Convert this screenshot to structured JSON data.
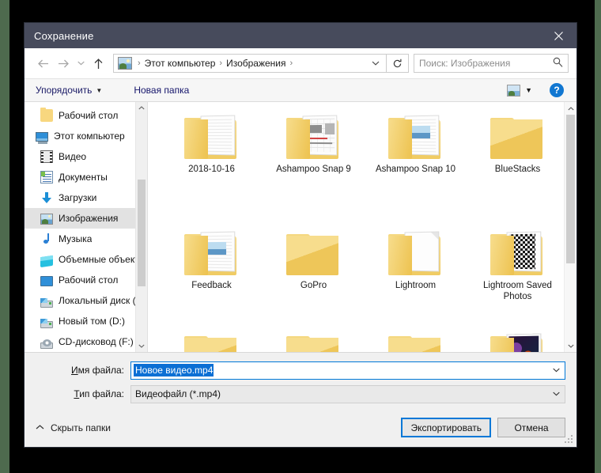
{
  "window": {
    "title": "Сохранение",
    "close_label": "×"
  },
  "nav": {
    "back_icon": "arrow-left-icon",
    "forward_icon": "arrow-right-icon",
    "recent_icon": "chevron-down-icon",
    "up_icon": "arrow-up-icon",
    "breadcrumbs": [
      "Этот компьютер",
      "Изображения"
    ],
    "separator": "›",
    "dropdown_icon": "chevron-down-icon",
    "refresh_icon": "refresh-icon",
    "refresh_glyph": "↻"
  },
  "search": {
    "placeholder": "Поиск: Изображения",
    "value": "",
    "icon": "search-icon"
  },
  "toolbar": {
    "organize_label": "Упорядочить",
    "organize_caret": "▼",
    "new_folder_label": "Новая папка",
    "view_icon": "picture-view-icon",
    "view_caret": "▼",
    "help_label": "?"
  },
  "sidebar": {
    "scroll_up_icon": "▲",
    "scroll_down_icon": "▼",
    "items": [
      {
        "label": "Рабочий стол",
        "icon": "folder-icon",
        "indent": true,
        "selected": false
      },
      {
        "label": "Этот компьютер",
        "icon": "computer-icon",
        "indent": false,
        "selected": false
      },
      {
        "label": "Видео",
        "icon": "video-icon",
        "indent": true,
        "selected": false
      },
      {
        "label": "Документы",
        "icon": "document-icon",
        "indent": true,
        "selected": false
      },
      {
        "label": "Загрузки",
        "icon": "download-icon",
        "indent": true,
        "selected": false
      },
      {
        "label": "Изображения",
        "icon": "pictures-icon",
        "indent": true,
        "selected": true
      },
      {
        "label": "Музыка",
        "icon": "music-icon",
        "indent": true,
        "selected": false
      },
      {
        "label": "Объемные объекты",
        "icon": "3d-objects-icon",
        "indent": true,
        "selected": false
      },
      {
        "label": "Рабочий стол",
        "icon": "desktop-icon",
        "indent": true,
        "selected": false
      },
      {
        "label": "Локальный диск (C:)",
        "icon": "drive-icon",
        "indent": true,
        "selected": false
      },
      {
        "label": "Новый том (D:)",
        "icon": "drive-icon",
        "indent": true,
        "selected": false
      },
      {
        "label": "CD-дисковод (F:)",
        "icon": "cd-drive-icon",
        "indent": true,
        "selected": false
      }
    ]
  },
  "files": {
    "scroll_up_icon": "▲",
    "scroll_down_icon": "▼",
    "items": [
      {
        "name": "2018-10-16",
        "type": "folder",
        "art": "paper"
      },
      {
        "name": "Ashampoo Snap 9",
        "type": "folder",
        "art": "snap"
      },
      {
        "name": "Ashampoo Snap 10",
        "type": "folder",
        "art": "photo-stack"
      },
      {
        "name": "BlueStacks",
        "type": "folder",
        "art": "empty"
      },
      {
        "name": "Feedback",
        "type": "folder",
        "art": "photo-stack"
      },
      {
        "name": "GoPro",
        "type": "folder",
        "art": "empty"
      },
      {
        "name": "Lightroom",
        "type": "folder",
        "art": "blank-page"
      },
      {
        "name": "Lightroom Saved Photos",
        "type": "folder",
        "art": "qr"
      }
    ],
    "partial_row": [
      {
        "name": "",
        "type": "folder",
        "art": "empty"
      },
      {
        "name": "",
        "type": "folder",
        "art": "empty"
      },
      {
        "name": "",
        "type": "folder",
        "art": "empty"
      },
      {
        "name": "",
        "type": "folder",
        "art": "art"
      }
    ]
  },
  "form": {
    "filename_label": "Имя файла:",
    "filename_label_accel": "И",
    "filename_label_rest": "мя файла:",
    "filename_value": "Новое видео.mp4",
    "filetype_label": "Тип файла:",
    "filetype_label_accel": "Т",
    "filetype_label_rest": "ип файла:",
    "filetype_value": "Видеофайл (*.mp4)",
    "combo_arrow": "⌄"
  },
  "actions": {
    "hide_folders_label": "Скрыть папки",
    "hide_folders_caret": "⌃",
    "export_label": "Экспортировать",
    "cancel_label": "Отмена"
  },
  "colors": {
    "titlebar": "#474b5c",
    "accent": "#0078d7",
    "selection": "#0b6fd4",
    "folder": "#f5d881",
    "link_text": "#15156b"
  }
}
